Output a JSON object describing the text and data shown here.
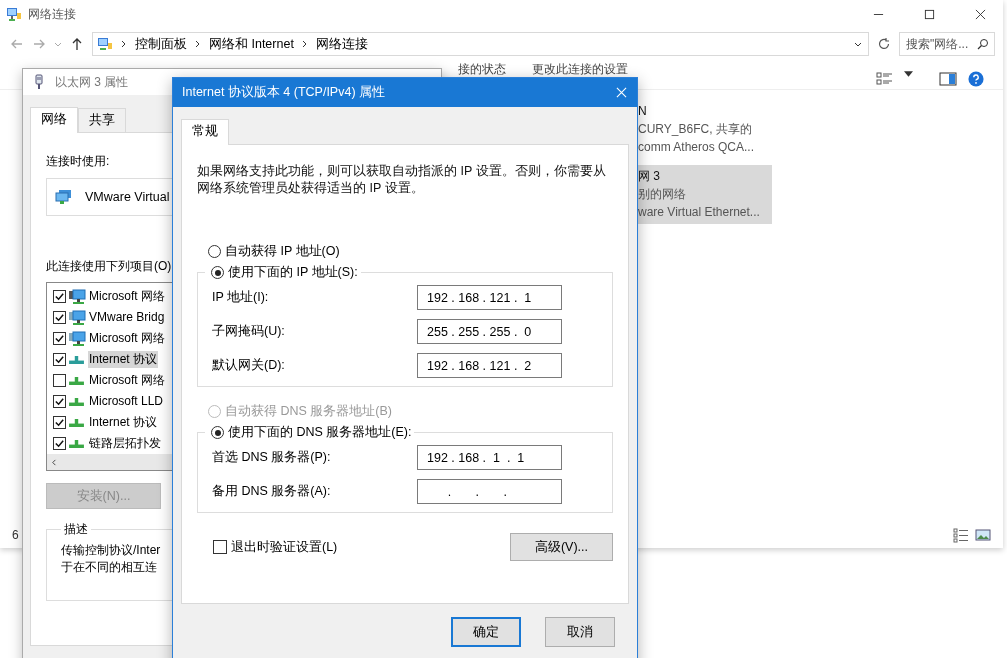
{
  "explorer": {
    "title": "网络连接",
    "breadcrumb": [
      "控制面板",
      "网络和 Internet",
      "网络连接"
    ],
    "search": {
      "placeholder": "搜索\"网络..."
    },
    "toolbar_texts": [
      "接的状态",
      "更改此连接的设置"
    ],
    "items": [
      {
        "lines": [
          "N",
          "CURY_B6FC, 共享的",
          "comm Atheros QCA..."
        ],
        "selected": false
      },
      {
        "lines": [
          "网 3",
          "别的网络",
          "ware Virtual Ethernet..."
        ],
        "selected": true
      }
    ],
    "status_count": "6"
  },
  "ethernet_dialog": {
    "title": "以太网 3 属性",
    "tabs": [
      {
        "label": "网络",
        "selected": true
      },
      {
        "label": "共享",
        "selected": false
      }
    ],
    "connect_using_label": "连接时使用:",
    "adapter": "VMware Virtual",
    "components_label": "此连接使用下列项目(O)",
    "components": [
      {
        "label": "Microsoft 网络",
        "checked": true,
        "selected": false,
        "kind": "client"
      },
      {
        "label": "VMware Bridg",
        "checked": true,
        "selected": false,
        "kind": "service"
      },
      {
        "label": "Microsoft 网络",
        "checked": true,
        "selected": false,
        "kind": "service"
      },
      {
        "label": "Internet 协议",
        "checked": true,
        "selected": true,
        "kind": "protocol"
      },
      {
        "label": "Microsoft 网络",
        "checked": false,
        "selected": false,
        "kind": "protocol"
      },
      {
        "label": "Microsoft LLD",
        "checked": true,
        "selected": false,
        "kind": "protocol"
      },
      {
        "label": "Internet 协议",
        "checked": true,
        "selected": false,
        "kind": "protocol"
      },
      {
        "label": "链路层拓扑发",
        "checked": true,
        "selected": false,
        "kind": "protocol"
      }
    ],
    "install_button": {
      "label": "安装(N)...",
      "disabled": true
    },
    "description": {
      "title": "描述",
      "lines": [
        "传输控制协议/Inter",
        "于在不同的相互连"
      ]
    }
  },
  "ipv4_dialog": {
    "title": "Internet 协议版本 4 (TCP/IPv4) 属性",
    "tabs": [
      {
        "label": "常规",
        "selected": true
      }
    ],
    "intro": "如果网络支持此功能，则可以获取自动指派的 IP 设置。否则，你需要从网络系统管理员处获得适当的 IP 设置。",
    "ip_auto": {
      "label": "自动获得 IP 地址(O)",
      "selected": false,
      "disabled": false
    },
    "ip_manual": {
      "label": "使用下面的 IP 地址(S):",
      "selected": true,
      "disabled": false
    },
    "ip_fields": [
      {
        "label": "IP 地址(I):",
        "value": "192 . 168 . 121 .  1"
      },
      {
        "label": "子网掩码(U):",
        "value": "255 . 255 . 255 .  0"
      },
      {
        "label": "默认网关(D):",
        "value": "192 . 168 . 121 .  2"
      }
    ],
    "dns_auto": {
      "label": "自动获得 DNS 服务器地址(B)",
      "selected": false,
      "disabled": true
    },
    "dns_manual": {
      "label": "使用下面的 DNS 服务器地址(E):",
      "selected": true,
      "disabled": false
    },
    "dns_fields": [
      {
        "label": "首选 DNS 服务器(P):",
        "value": "192 . 168 .  1  .  1"
      },
      {
        "label": "备用 DNS 服务器(A):",
        "value": "      .       .       ."
      }
    ],
    "validate": {
      "label": "退出时验证设置(L)",
      "checked": false
    },
    "advanced_button": "高级(V)...",
    "ok_button": "确定",
    "cancel_button": "取消"
  }
}
